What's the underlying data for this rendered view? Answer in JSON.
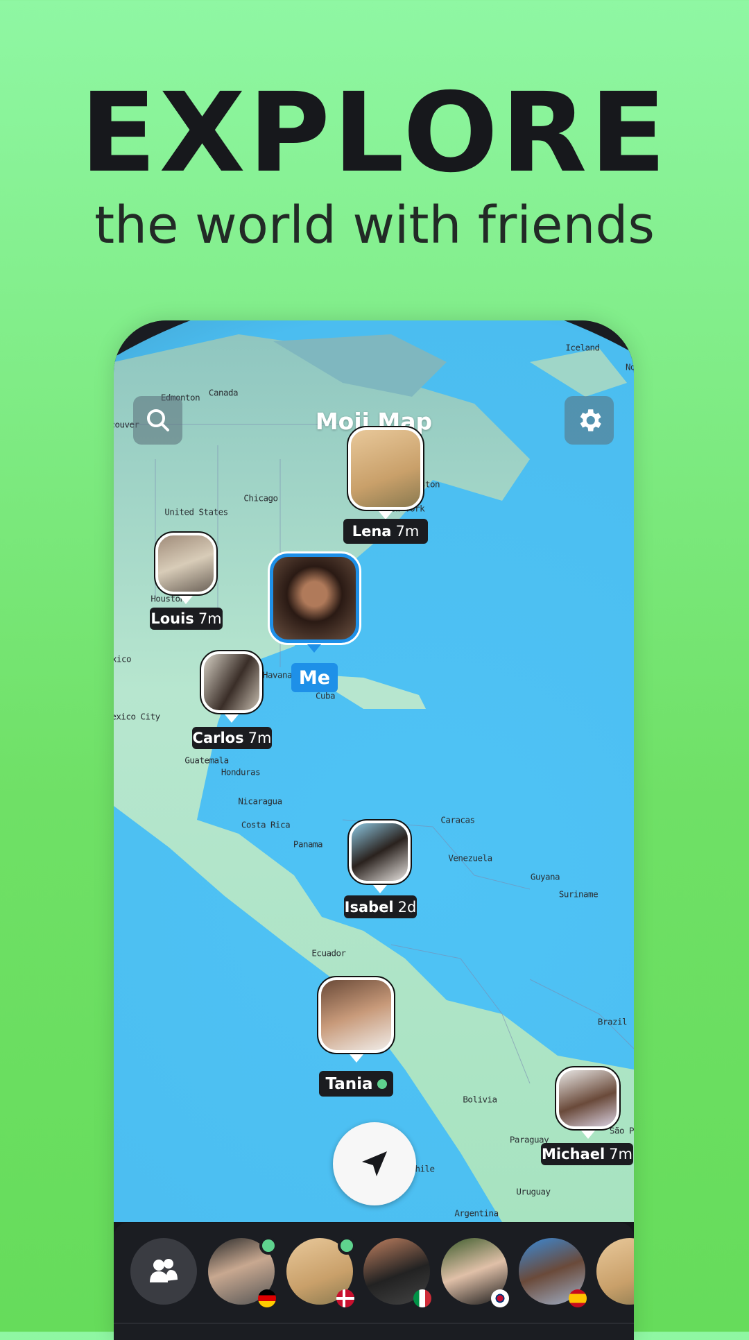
{
  "headline": "EXPLORE",
  "subtitle": "the world with friends",
  "app": {
    "title": "Moji Map",
    "search_icon": "search-icon",
    "settings_icon": "gear-icon",
    "locate_icon": "navigation-arrow-icon"
  },
  "map_labels": [
    "Iceland",
    "Canada",
    "Edmonton",
    "ncouver",
    "Chicago",
    "United States",
    "New York",
    "ston",
    "Houston",
    "xico",
    "Havana",
    "Cuba",
    "Mexico City",
    "Guatemala",
    "Honduras",
    "Nicaragua",
    "Costa Rica",
    "Panama",
    "Caracas",
    "Venezuela",
    "Guyana",
    "Suriname",
    "Ecuador",
    "Brazil",
    "Bolivia",
    "Paraguay",
    "Chile",
    "Uruguay",
    "Argentina",
    "São Pa",
    "No"
  ],
  "markers": [
    {
      "name": "Lena",
      "time": "7m"
    },
    {
      "name": "Louis",
      "time": "7m"
    },
    {
      "name": "Me"
    },
    {
      "name": "Carlos",
      "time": "7m"
    },
    {
      "name": "Isabel",
      "time": "2d"
    },
    {
      "name": "Tania",
      "online": true
    },
    {
      "name": "Michael",
      "time": "7m"
    }
  ],
  "colors": {
    "me_accent": "#1e90e8",
    "online": "#5fd38e",
    "background": "#7ded7a"
  },
  "friends_bar": {
    "friends_icon": "friends-icon",
    "friends": [
      {
        "online": true,
        "flag": "Germany"
      },
      {
        "online": true,
        "flag": "Denmark"
      },
      {
        "online": false,
        "flag": "Italy"
      },
      {
        "online": false,
        "flag": "South Korea"
      },
      {
        "online": false,
        "flag": "Spain"
      },
      {
        "online": false,
        "flag": ""
      }
    ]
  }
}
